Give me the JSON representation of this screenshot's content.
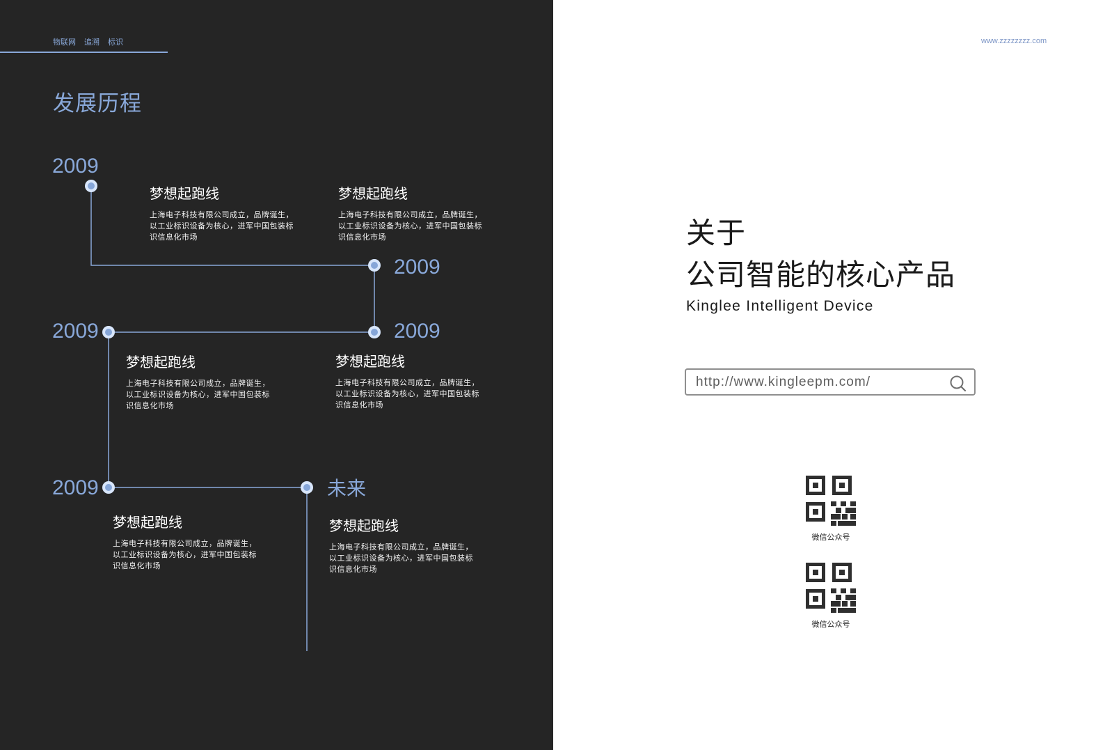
{
  "left_panel": {
    "tags": [
      "物联网",
      "追溯",
      "标识"
    ],
    "section_title": "发展历程",
    "timeline": {
      "years": [
        "2009",
        "2009",
        "2009",
        "2009",
        "2009"
      ],
      "future": "未来",
      "cards": [
        {
          "title": "梦想起跑线",
          "description": "上海电子科技有限公司成立，品牌诞生，以工业标识设备为核心，进军中国包装标识信息化市场"
        },
        {
          "title": "梦想起跑线",
          "description": "上海电子科技有限公司成立，品牌诞生，以工业标识设备为核心，进军中国包装标识信息化市场"
        },
        {
          "title": "梦想起跑线",
          "description": "上海电子科技有限公司成立，品牌诞生，以工业标识设备为核心，进军中国包装标识信息化市场"
        },
        {
          "title": "梦想起跑线",
          "description": "上海电子科技有限公司成立，品牌诞生，以工业标识设备为核心，进军中国包装标识信息化市场"
        },
        {
          "title": "梦想起跑线",
          "description": "上海电子科技有限公司成立，品牌诞生，以工业标识设备为核心，进军中国包装标识信息化市场"
        },
        {
          "title": "梦想起跑线",
          "description": "上海电子科技有限公司成立，品牌诞生，以工业标识设备为核心，进军中国包装标识信息化市场"
        }
      ]
    }
  },
  "right_panel": {
    "website": "www.zzzzzzzz.com",
    "about": {
      "line1": "关于",
      "line2": "公司智能的核心产品",
      "subtitle": "Kinglee Intelligent Device"
    },
    "search": {
      "value": "http://www.kingleepm.com/"
    },
    "qr_codes": [
      {
        "label": "微信公众号",
        "icon": "qr-code-icon"
      },
      {
        "label": "微信公众号",
        "icon": "qr-code-icon"
      }
    ]
  },
  "colors": {
    "left_background": "#252525",
    "accent": "#89a8d9",
    "white": "#ffffff",
    "dark_text": "#1a1a1a"
  }
}
